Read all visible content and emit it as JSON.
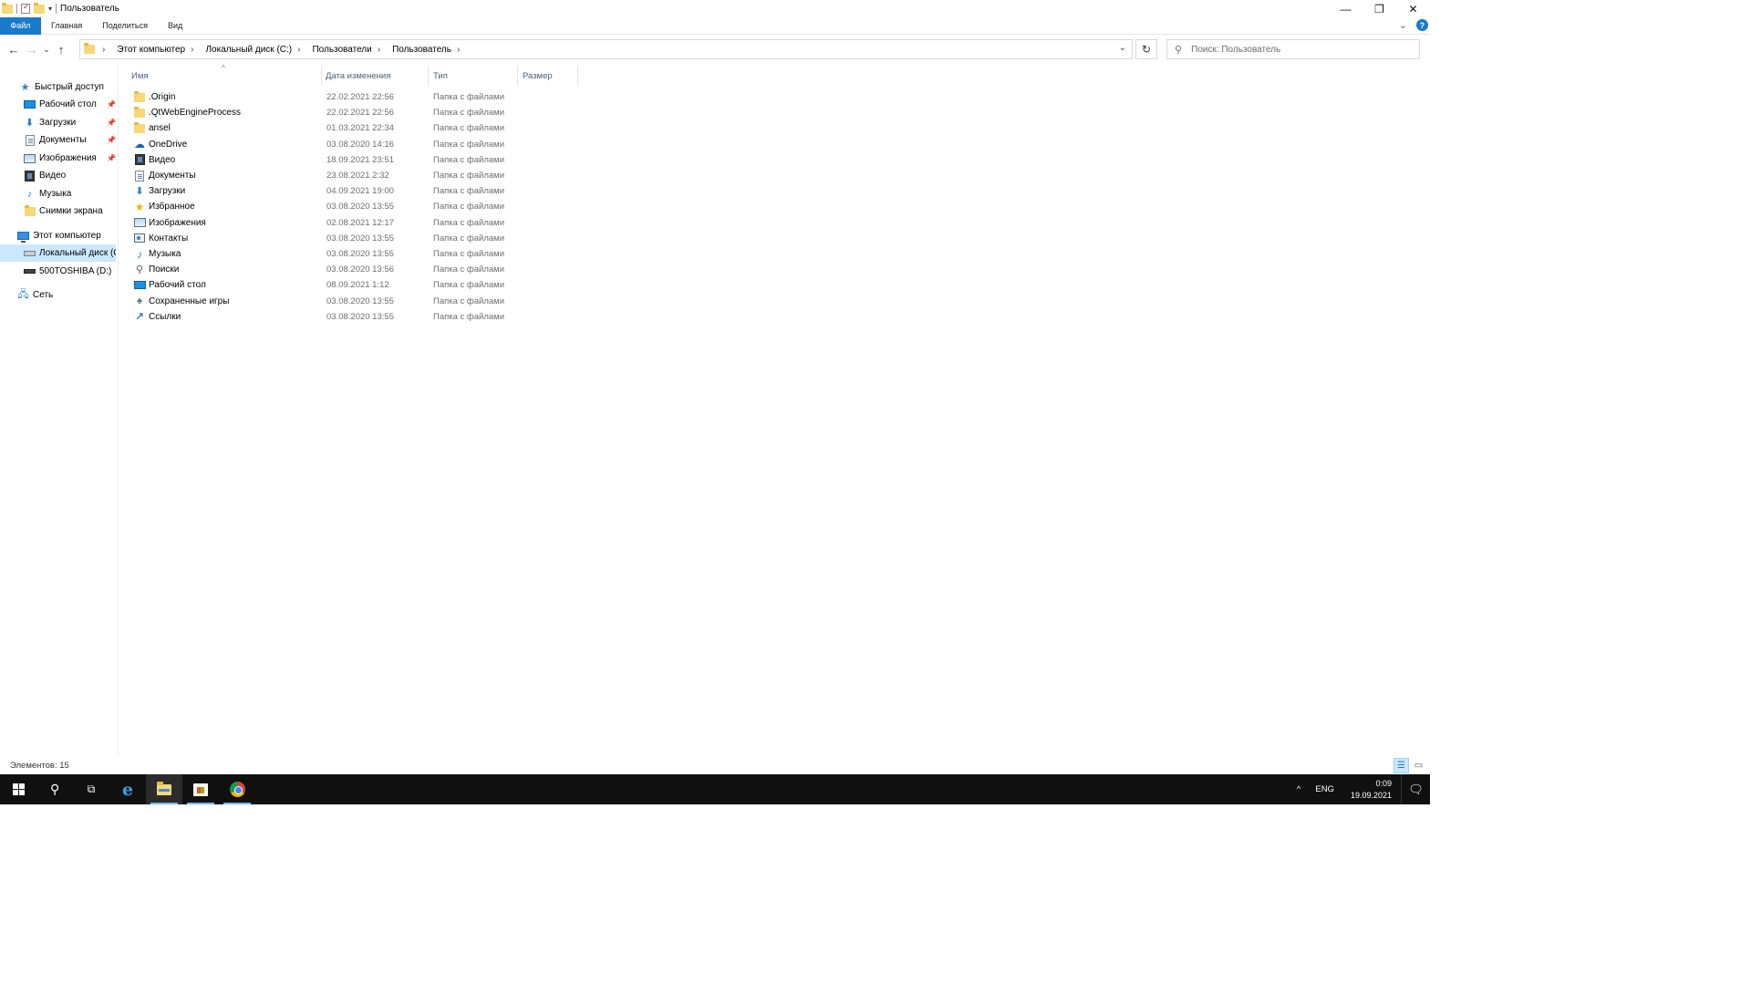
{
  "window": {
    "title": "Пользователь",
    "minimize_glyph": "—",
    "restore_glyph": "❐",
    "close_glyph": "✕"
  },
  "ribbon": {
    "tabs": [
      "Файл",
      "Главная",
      "Поделиться",
      "Вид"
    ],
    "expand_glyph": "⌄",
    "help_glyph": "?"
  },
  "nav": {
    "back_glyph": "←",
    "forward_glyph": "→",
    "recent_glyph": "⌄",
    "up_glyph": "↑",
    "breadcrumbs": [
      "Этот компьютер",
      "Локальный диск (C:)",
      "Пользователи",
      "Пользователь"
    ],
    "chevron_glyph": "›",
    "refresh_glyph": "↻",
    "search_placeholder": "Поиск: Пользователь"
  },
  "sidebar": {
    "quick_access": "Быстрый доступ",
    "pinned": [
      {
        "label": "Рабочий стол",
        "icon": "desktop-icon"
      },
      {
        "label": "Загрузки",
        "icon": "downloads-icon"
      },
      {
        "label": "Документы",
        "icon": "documents-icon"
      },
      {
        "label": "Изображения",
        "icon": "pictures-icon"
      }
    ],
    "unpinned": [
      {
        "label": "Видео",
        "icon": "video-icon"
      },
      {
        "label": "Музыка",
        "icon": "music-icon"
      },
      {
        "label": "Снимки экрана",
        "icon": "folder-icon"
      }
    ],
    "this_pc": "Этот компьютер",
    "drives": [
      {
        "label": "Локальный диск (C:)",
        "selected": true
      },
      {
        "label": "500TOSHIBA (D:)",
        "selected": false
      }
    ],
    "network": "Сеть",
    "pin_glyph": "📌"
  },
  "columns": {
    "name": "Имя",
    "date": "Дата изменения",
    "type": "Тип",
    "size": "Размер"
  },
  "files": [
    {
      "name": ".Origin",
      "date": "22.02.2021 22:56",
      "type": "Папка с файлами",
      "icon": "folder-icon"
    },
    {
      "name": ".QtWebEngineProcess",
      "date": "22.02.2021 22:56",
      "type": "Папка с файлами",
      "icon": "folder-icon"
    },
    {
      "name": "ansel",
      "date": "01.03.2021 22:34",
      "type": "Папка с файлами",
      "icon": "folder-icon"
    },
    {
      "name": "OneDrive",
      "date": "03.08.2020 14:16",
      "type": "Папка с файлами",
      "icon": "onedrive-icon"
    },
    {
      "name": "Видео",
      "date": "18.09.2021 23:51",
      "type": "Папка с файлами",
      "icon": "video-icon"
    },
    {
      "name": "Документы",
      "date": "23.08.2021 2:32",
      "type": "Папка с файлами",
      "icon": "documents-icon"
    },
    {
      "name": "Загрузки",
      "date": "04.09.2021 19:00",
      "type": "Папка с файлами",
      "icon": "downloads-icon"
    },
    {
      "name": "Избранное",
      "date": "03.08.2020 13:55",
      "type": "Папка с файлами",
      "icon": "favorites-icon"
    },
    {
      "name": "Изображения",
      "date": "02.08.2021 12:17",
      "type": "Папка с файлами",
      "icon": "pictures-icon"
    },
    {
      "name": "Контакты",
      "date": "03.08.2020 13:55",
      "type": "Папка с файлами",
      "icon": "contacts-icon"
    },
    {
      "name": "Музыка",
      "date": "03.08.2020 13:55",
      "type": "Папка с файлами",
      "icon": "music-icon"
    },
    {
      "name": "Поиски",
      "date": "03.08.2020 13:56",
      "type": "Папка с файлами",
      "icon": "searches-icon"
    },
    {
      "name": "Рабочий стол",
      "date": "08.09.2021 1:12",
      "type": "Папка с файлами",
      "icon": "desktop-icon"
    },
    {
      "name": "Сохраненные игры",
      "date": "03.08.2020 13:55",
      "type": "Папка с файлами",
      "icon": "saved-games-icon"
    },
    {
      "name": "Ссылки",
      "date": "03.08.2020 13:55",
      "type": "Папка с файлами",
      "icon": "links-icon"
    }
  ],
  "status": {
    "item_count": "Элементов: 15"
  },
  "taskbar": {
    "language": "ENG",
    "time": "0:09",
    "date": "19.09.2021",
    "tray_up_glyph": "^",
    "notification_glyph": "🗨"
  }
}
